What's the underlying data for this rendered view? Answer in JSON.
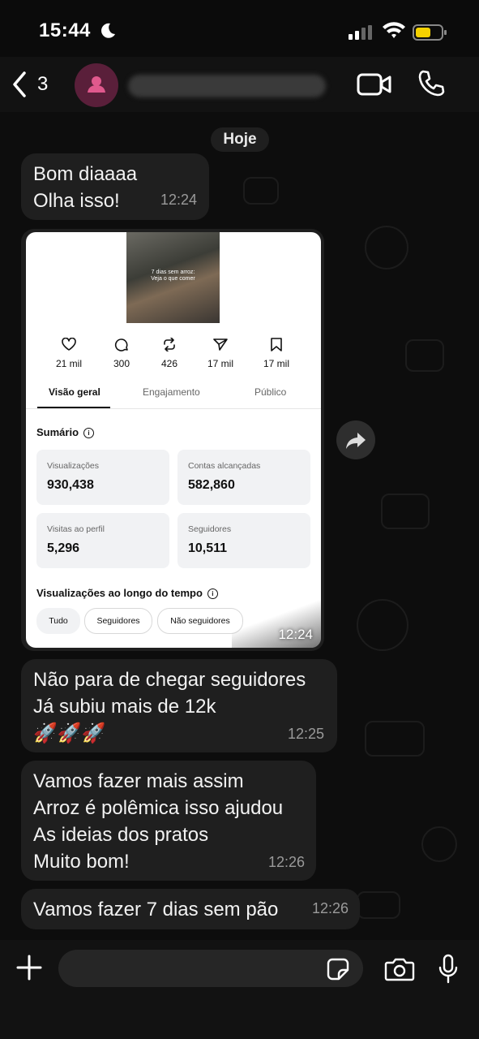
{
  "status_bar": {
    "time": "15:44"
  },
  "header": {
    "unread_count": "3",
    "contact_name": ""
  },
  "chat": {
    "date_label": "Hoje",
    "messages": [
      {
        "text": "Bom diaaaa\nOlha isso!",
        "time": "12:24"
      },
      {
        "text": "Não para de chegar seguidores\nJá subiu  mais de 12k\n🚀🚀🚀",
        "time": "12:25"
      },
      {
        "text": "Vamos fazer mais assim\nArroz é polêmica isso ajudou\nAs ideias dos pratos\nMuito bom!",
        "time": "12:26"
      },
      {
        "text": "Vamos fazer 7 dias sem pão",
        "time": "12:26"
      }
    ],
    "image_message": {
      "time": "12:24",
      "thumbnail_caption": "7 dias sem arroz:\nVeja o que comer",
      "stats": [
        {
          "icon": "heart-icon",
          "value": "21 mil"
        },
        {
          "icon": "comment-icon",
          "value": "300"
        },
        {
          "icon": "repost-icon",
          "value": "426"
        },
        {
          "icon": "share-icon",
          "value": "17 mil"
        },
        {
          "icon": "bookmark-icon",
          "value": "17 mil"
        }
      ],
      "tabs": [
        "Visão geral",
        "Engajamento",
        "Público"
      ],
      "summary_title": "Sumário",
      "metrics": [
        {
          "label": "Visualizações",
          "value": "930,438"
        },
        {
          "label": "Contas alcançadas",
          "value": "582,860"
        },
        {
          "label": "Visitas ao perfil",
          "value": "5,296"
        },
        {
          "label": "Seguidores",
          "value": "10,511"
        }
      ],
      "chart_title": "Visualizações ao longo do tempo",
      "filters": [
        "Tudo",
        "Seguidores",
        "Não seguidores"
      ]
    }
  },
  "colors": {
    "background": "#0b0b0b",
    "bubble": "#1f1f1f",
    "avatar": "#5a1f3a",
    "avatar_icon": "#e0598d",
    "battery": "#f5d100"
  }
}
